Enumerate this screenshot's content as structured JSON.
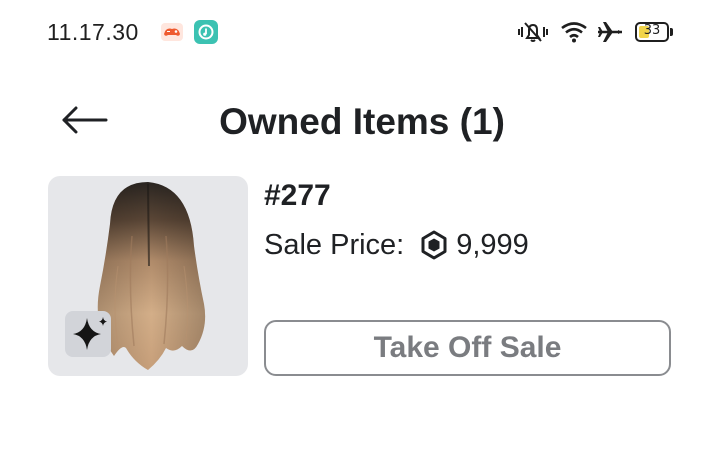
{
  "status_bar": {
    "time": "11.17.30",
    "battery_level": "33",
    "icons": [
      "game-notification-icon",
      "music-notification-icon",
      "silent-icon",
      "wifi-icon",
      "airplane-mode-icon",
      "battery-icon"
    ]
  },
  "header": {
    "back_icon": "arrow-left-icon",
    "title": "Owned Items (1)"
  },
  "item": {
    "name": "#277",
    "price_label": "Sale Price:",
    "currency_icon": "robux-icon",
    "price_value": "9,999",
    "badge_icon": "sparkle-icon",
    "action_label": "Take Off Sale"
  },
  "colors": {
    "text": "#1f2124",
    "thumbnail_bg": "#e6e7ea",
    "button_border": "#8a8c90",
    "button_text": "#7a7c80",
    "battery_fill": "#f2d54b"
  }
}
